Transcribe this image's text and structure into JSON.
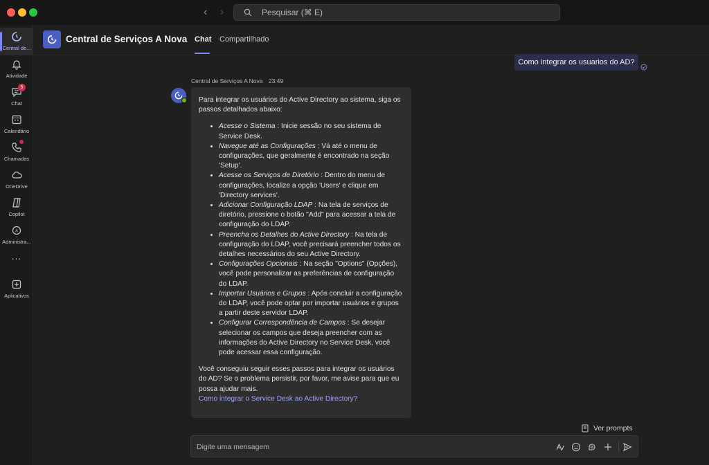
{
  "search": {
    "placeholder": "Pesquisar (⌘ E)"
  },
  "rail": {
    "items": [
      {
        "label": "Central de...",
        "icon": "bot-icon"
      },
      {
        "label": "Atividade",
        "icon": "bell-icon"
      },
      {
        "label": "Chat",
        "icon": "chat-icon",
        "badge": "5"
      },
      {
        "label": "Calendário",
        "icon": "calendar-icon"
      },
      {
        "label": "Chamadas",
        "icon": "phone-icon"
      },
      {
        "label": "OneDrive",
        "icon": "cloud-icon"
      },
      {
        "label": "Copilot",
        "icon": "copilot-icon"
      },
      {
        "label": "Administra...",
        "icon": "admin-icon"
      },
      {
        "label": "...",
        "icon": "more-icon"
      },
      {
        "label": "Aplicativos",
        "icon": "add-app-icon"
      }
    ]
  },
  "header": {
    "title": "Central de Serviços A Nova",
    "tabs": [
      "Chat",
      "Compartilhado"
    ]
  },
  "conversation": {
    "user_message": "Como integrar os usuarios do AD?",
    "bot_sender": "Central de Serviços A Nova",
    "bot_time": "23:49",
    "bot_intro": "Para integrar os usuários do Active Directory ao sistema, siga os passos detalhados abaixo:",
    "steps": [
      {
        "title": "Acesse o Sistema",
        "text": " : Inicie sessão no seu sistema de Service Desk."
      },
      {
        "title": "Navegue até as Configurações",
        "text": " : Vá até o menu de configurações, que geralmente é encontrado na seção 'Setup'."
      },
      {
        "title": "Acesse os Serviços de Diretório",
        "text": " : Dentro do menu de configurações, localize a opção 'Users' e clique em 'Directory services'."
      },
      {
        "title": "Adicionar Configuração LDAP",
        "text": " : Na tela de serviços de diretório, pressione o botão \"Add\" para acessar a tela de configuração do LDAP."
      },
      {
        "title": "Preencha os Detalhes do Active Directory",
        "text": " : Na tela de configuração do LDAP, você precisará preencher todos os detalhes necessários do seu Active Directory."
      },
      {
        "title": "Configurações Opcionais",
        "text": " : Na seção \"Options\" (Opções), você pode personalizar as preferências de configuração do LDAP."
      },
      {
        "title": "Importar Usuários e Grupos",
        "text": " : Após concluir a configuração do LDAP, você pode optar por importar usuários e grupos a partir deste servidor LDAP."
      },
      {
        "title": "Configurar Correspondência de Campos",
        "text": " : Se desejar selecionar os campos que deseja preencher com as informações do Active Directory no Service Desk, você pode acessar essa configuração."
      }
    ],
    "bot_outro": "Você conseguiu seguir esses passos para integrar os usuários do AD? Se o problema persistir, por favor, me avise para que eu possa ajudar mais.",
    "suggested_prompt": "Como integrar o Service Desk ao Active Directory?"
  },
  "composer": {
    "placeholder": "Digite uma mensagem",
    "prompts_label": "Ver prompts"
  },
  "colors": {
    "accent": "#7f85f5",
    "user_bubble": "#2b2d4a",
    "bot_bubble": "#2e2e2e",
    "badge": "#c4314b",
    "presence": "#6bb700"
  }
}
